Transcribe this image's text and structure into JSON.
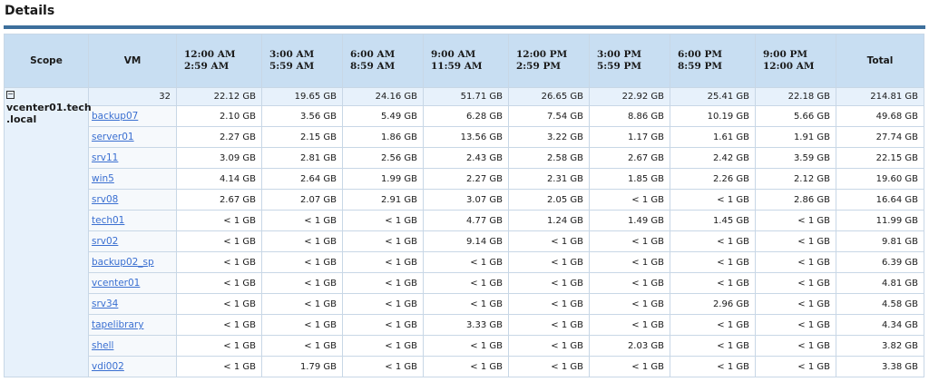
{
  "page": {
    "title": "Details"
  },
  "table": {
    "headers": {
      "scope": "Scope",
      "vm": "VM",
      "times": [
        [
          "12:00 AM",
          "2:59 AM"
        ],
        [
          "3:00 AM",
          "5:59 AM"
        ],
        [
          "6:00 AM",
          "8:59 AM"
        ],
        [
          "9:00 AM",
          "11:59 AM"
        ],
        [
          "12:00 PM",
          "2:59 PM"
        ],
        [
          "3:00 PM",
          "5:59 PM"
        ],
        [
          "6:00 PM",
          "8:59 PM"
        ],
        [
          "9:00 PM",
          "12:00 AM"
        ]
      ],
      "total": "Total"
    },
    "scope": {
      "collapse_symbol": "⊟",
      "line1": "vcenter01.tech",
      "line2": ".local"
    },
    "summary": {
      "vm_count": "32",
      "values": [
        "22.12 GB",
        "19.65 GB",
        "24.16 GB",
        "51.71 GB",
        "26.65 GB",
        "22.92 GB",
        "25.41 GB",
        "22.18 GB"
      ],
      "total": "214.81 GB"
    },
    "rows": [
      {
        "vm": "backup07",
        "values": [
          "2.10 GB",
          "3.56 GB",
          "5.49 GB",
          "6.28 GB",
          "7.54 GB",
          "8.86 GB",
          "10.19 GB",
          "5.66 GB"
        ],
        "total": "49.68 GB"
      },
      {
        "vm": "server01",
        "values": [
          "2.27 GB",
          "2.15 GB",
          "1.86 GB",
          "13.56 GB",
          "3.22 GB",
          "1.17 GB",
          "1.61 GB",
          "1.91 GB"
        ],
        "total": "27.74 GB"
      },
      {
        "vm": "srv11",
        "values": [
          "3.09 GB",
          "2.81 GB",
          "2.56 GB",
          "2.43 GB",
          "2.58 GB",
          "2.67 GB",
          "2.42 GB",
          "3.59 GB"
        ],
        "total": "22.15 GB"
      },
      {
        "vm": "win5",
        "values": [
          "4.14 GB",
          "2.64 GB",
          "1.99 GB",
          "2.27 GB",
          "2.31 GB",
          "1.85 GB",
          "2.26 GB",
          "2.12 GB"
        ],
        "total": "19.60 GB"
      },
      {
        "vm": "srv08",
        "values": [
          "2.67 GB",
          "2.07 GB",
          "2.91 GB",
          "3.07 GB",
          "2.05 GB",
          "< 1 GB",
          "< 1 GB",
          "2.86 GB"
        ],
        "total": "16.64 GB"
      },
      {
        "vm": "tech01",
        "values": [
          "< 1 GB",
          "< 1 GB",
          "< 1 GB",
          "4.77 GB",
          "1.24 GB",
          "1.49 GB",
          "1.45 GB",
          "< 1 GB"
        ],
        "total": "11.99 GB"
      },
      {
        "vm": "srv02",
        "values": [
          "< 1 GB",
          "< 1 GB",
          "< 1 GB",
          "9.14 GB",
          "< 1 GB",
          "< 1 GB",
          "< 1 GB",
          "< 1 GB"
        ],
        "total": "9.81 GB"
      },
      {
        "vm": "backup02_sp",
        "values": [
          "< 1 GB",
          "< 1 GB",
          "< 1 GB",
          "< 1 GB",
          "< 1 GB",
          "< 1 GB",
          "< 1 GB",
          "< 1 GB"
        ],
        "total": "6.39 GB"
      },
      {
        "vm": "vcenter01",
        "values": [
          "< 1 GB",
          "< 1 GB",
          "< 1 GB",
          "< 1 GB",
          "< 1 GB",
          "< 1 GB",
          "< 1 GB",
          "< 1 GB"
        ],
        "total": "4.81 GB"
      },
      {
        "vm": "srv34",
        "values": [
          "< 1 GB",
          "< 1 GB",
          "< 1 GB",
          "< 1 GB",
          "< 1 GB",
          "< 1 GB",
          "2.96 GB",
          "< 1 GB"
        ],
        "total": "4.58 GB"
      },
      {
        "vm": "tapelibrary",
        "values": [
          "< 1 GB",
          "< 1 GB",
          "< 1 GB",
          "3.33 GB",
          "< 1 GB",
          "< 1 GB",
          "< 1 GB",
          "< 1 GB"
        ],
        "total": "4.34 GB"
      },
      {
        "vm": "shell",
        "values": [
          "< 1 GB",
          "< 1 GB",
          "< 1 GB",
          "< 1 GB",
          "< 1 GB",
          "2.03 GB",
          "< 1 GB",
          "< 1 GB"
        ],
        "total": "3.82 GB"
      },
      {
        "vm": "vdi002",
        "values": [
          "< 1 GB",
          "1.79 GB",
          "< 1 GB",
          "< 1 GB",
          "< 1 GB",
          "< 1 GB",
          "< 1 GB",
          "< 1 GB"
        ],
        "total": "3.38 GB"
      }
    ]
  }
}
